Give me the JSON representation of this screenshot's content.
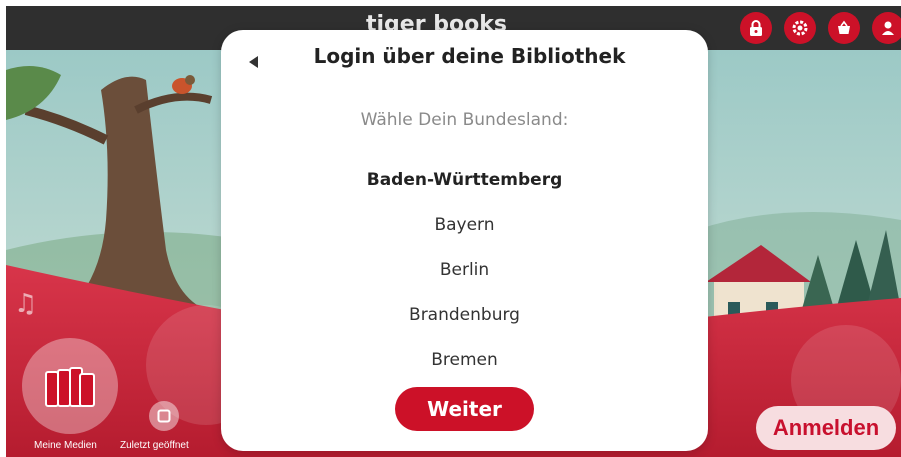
{
  "app": {
    "title": "tiger books"
  },
  "topbar": {
    "icons": [
      "lock-icon",
      "gear-icon",
      "shop-basket-icon",
      "profile-icon"
    ]
  },
  "modal": {
    "title": "Login über deine Bibliothek",
    "subtitle": "Wähle Dein Bundesland:",
    "states": [
      "Baden-Württemberg",
      "Bayern",
      "Berlin",
      "Brandenburg",
      "Bremen"
    ],
    "selected_state": "Baden-Württemberg",
    "continue_label": "Weiter"
  },
  "dock": {
    "my_media_label": "Meine Medien",
    "recent_label": "Zuletzt geöffnet",
    "login_label": "Anmelden"
  },
  "colors": {
    "brand_red": "#cc1128",
    "topbar": "#2f2f2f",
    "login_button_bg": "#f7dde0"
  }
}
